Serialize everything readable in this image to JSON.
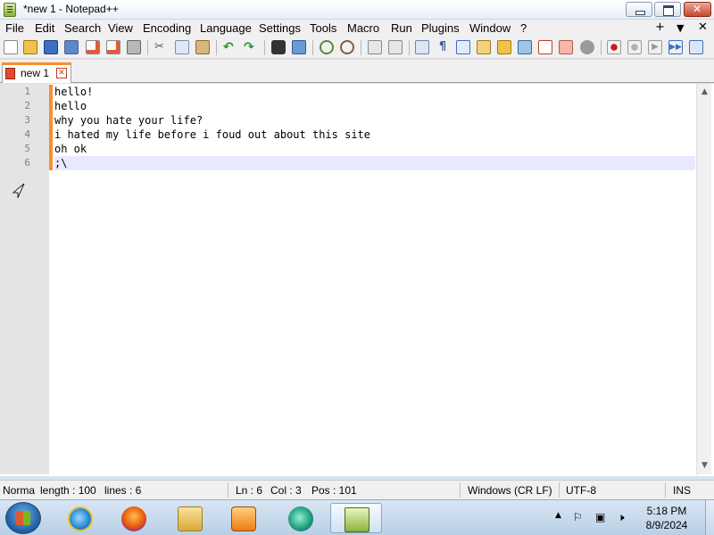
{
  "window": {
    "title": "*new 1 - Notepad++"
  },
  "menu": {
    "items": [
      "File",
      "Edit",
      "Search",
      "View",
      "Encoding",
      "Language",
      "Settings",
      "Tools",
      "Macro",
      "Run",
      "Plugins",
      "Window",
      "?"
    ],
    "right": {
      "plus": "+",
      "dropdown": "▼",
      "close": "✕"
    }
  },
  "tabs": [
    {
      "label": "new 1"
    }
  ],
  "editor": {
    "line_numbers": [
      "1",
      "2",
      "3",
      "4",
      "5",
      "6"
    ],
    "lines": [
      "hello!",
      "hello",
      "why you hate your life?",
      "i hated my life before i foud out about this site",
      "oh ok",
      ";\\"
    ]
  },
  "status": {
    "file_type": "Norma",
    "length": "length : 100",
    "lines": "lines : 6",
    "ln": "Ln : 6",
    "col": "Col : 3",
    "pos": "Pos : 101",
    "eol": "Windows (CR LF)",
    "encoding": "UTF-8",
    "mode": "INS"
  },
  "taskbar": {
    "apps": [
      "Internet Explorer",
      "Firefox",
      "Windows Explorer",
      "Windows Media Player",
      "Browser",
      "Notepad++"
    ],
    "clock_time": "5:18 PM",
    "clock_date": "8/9/2024"
  },
  "colors": {
    "tab_accent": "#fa8f2d",
    "current_line": "#e8e8ff",
    "gutter": "#e4e4e4"
  }
}
